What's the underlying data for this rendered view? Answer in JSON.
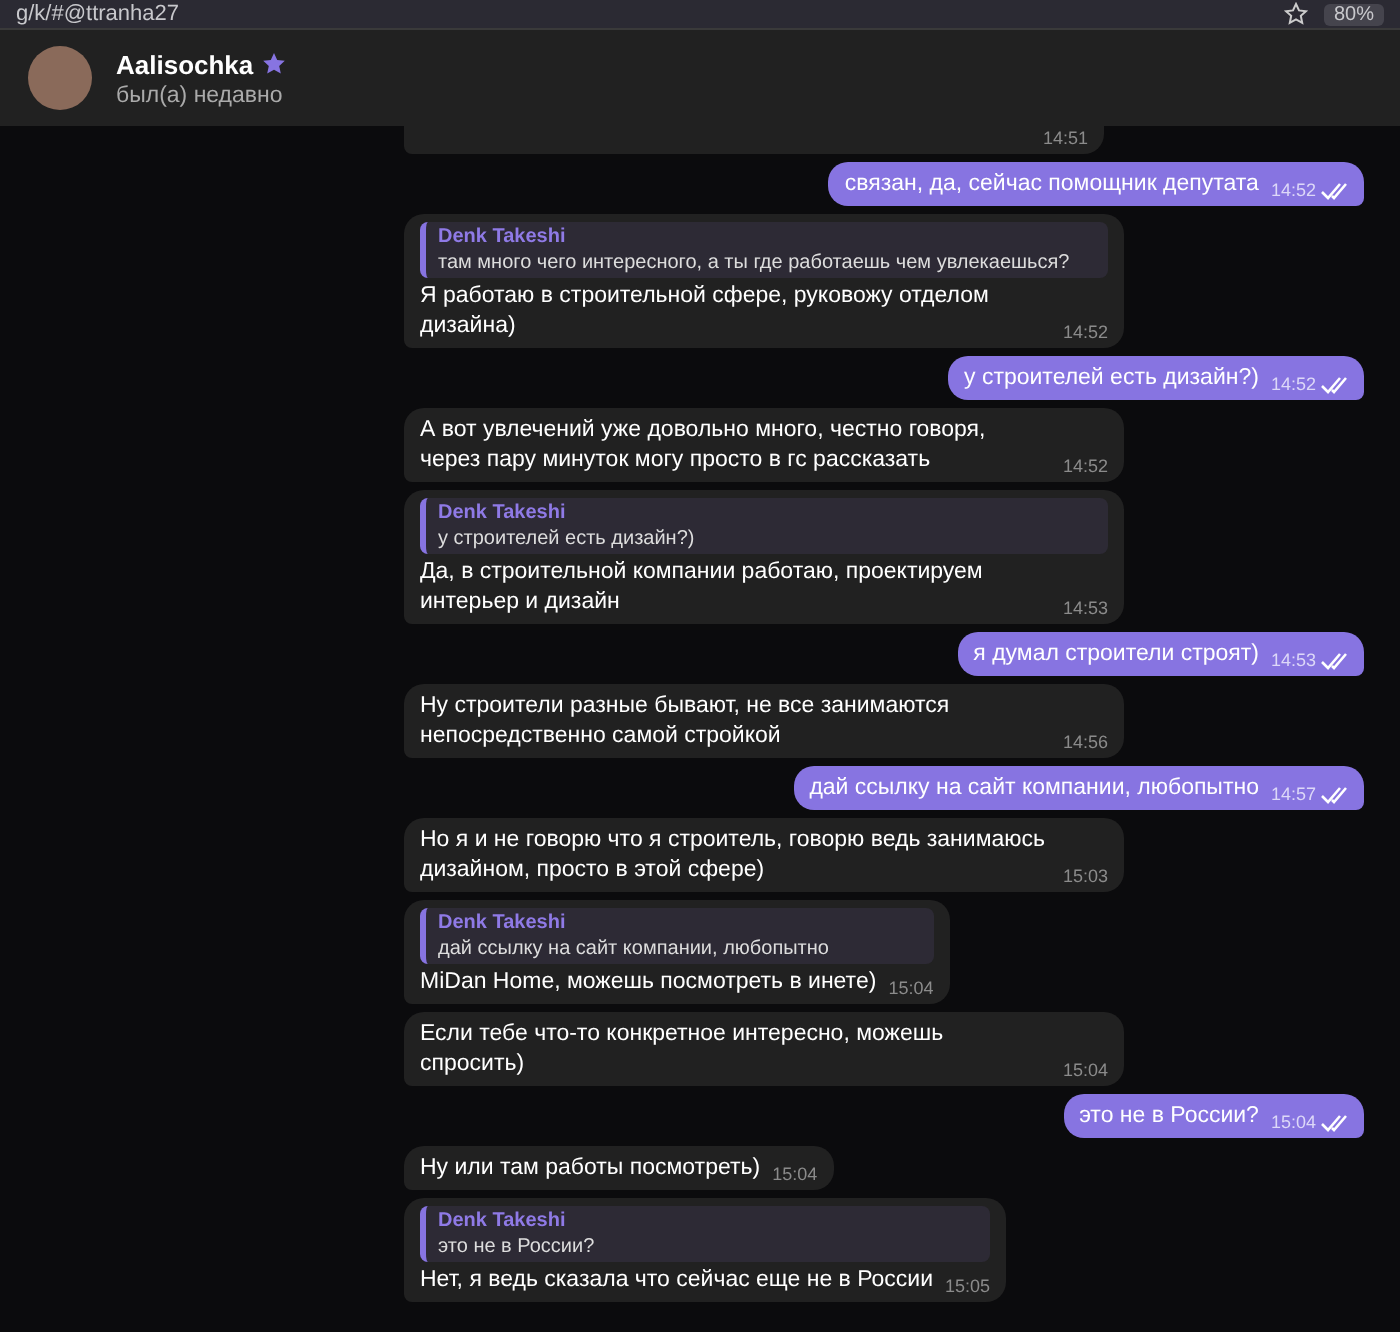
{
  "browser_bar": {
    "url": "g/k/#@ttranha27",
    "zoom": "80%"
  },
  "chat_header": {
    "name": "Aalisochka",
    "premium": true,
    "status": "был(а) недавно"
  },
  "messages": [
    {
      "kind": "in",
      "time": "14:51"
    },
    {
      "kind": "out",
      "text": "связан, да, сейчас помощник депутата",
      "time": "14:52",
      "read": true
    },
    {
      "kind": "in",
      "reply": {
        "author": "Denk Takeshi",
        "text": "там много чего интересного, а ты где работаешь чем увлекаешься?"
      },
      "text": "Я работаю в строительной сфере, руковожу отделом дизайна)",
      "time": "14:52"
    },
    {
      "kind": "out",
      "text": "у строителей есть дизайн?)",
      "time": "14:52",
      "read": true
    },
    {
      "kind": "in",
      "text": "А вот увлечений уже довольно много, честно говоря, через пару минуток могу просто в гс рассказать",
      "time": "14:52"
    },
    {
      "kind": "in",
      "reply": {
        "author": "Denk Takeshi",
        "text": "у строителей есть дизайн?)"
      },
      "text": "Да, в строительной компании работаю, проектируем интерьер и дизайн",
      "time": "14:53"
    },
    {
      "kind": "out",
      "text": "я думал строители строят)",
      "time": "14:53",
      "read": true
    },
    {
      "kind": "in",
      "text": "Ну строители разные бывают, не все занимаются непосредственно самой стройкой",
      "time": "14:56"
    },
    {
      "kind": "out",
      "text": "дай ссылку на сайт компании, любопытно",
      "time": "14:57",
      "read": true
    },
    {
      "kind": "in",
      "text": "Но я и не говорю что я строитель, говорю ведь занимаюсь дизайном, просто в этой сфере)",
      "time": "15:03"
    },
    {
      "kind": "in",
      "reply": {
        "author": "Denk Takeshi",
        "text": "дай ссылку на сайт компании, любопытно"
      },
      "text": "MiDan Home, можешь посмотреть в инете)",
      "time": "15:04"
    },
    {
      "kind": "in",
      "text": "Если тебе что-то конкретное интересно, можешь спросить)",
      "time": "15:04"
    },
    {
      "kind": "out",
      "text": "это не в России?",
      "time": "15:04",
      "read": true
    },
    {
      "kind": "in",
      "text": "Ну или там работы посмотреть)",
      "time": "15:04"
    },
    {
      "kind": "in",
      "reply": {
        "author": "Denk Takeshi",
        "text": "это не в России?"
      },
      "text": "Нет, я ведь сказала что сейчас еще не в России",
      "time": "15:05"
    }
  ]
}
